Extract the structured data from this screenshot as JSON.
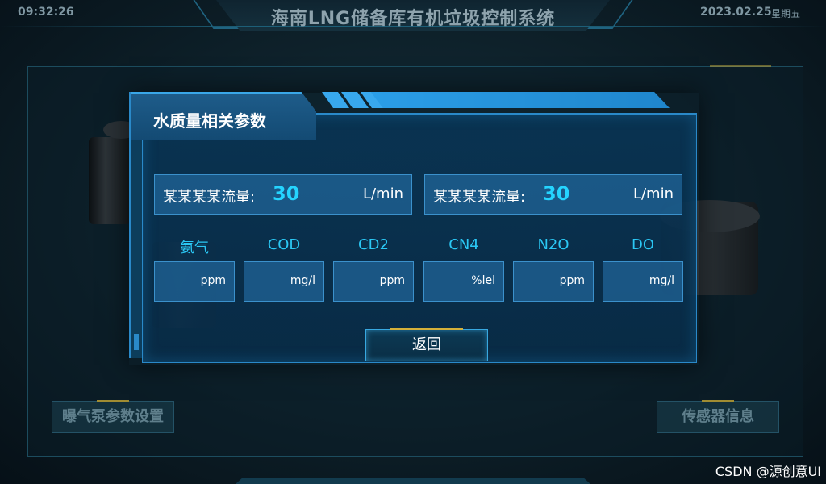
{
  "header": {
    "time": "09:32:26",
    "title": "海南LNG储备库有机垃圾控制系统",
    "date": "2023.02.25",
    "weekday": "星期五"
  },
  "background": {
    "left_button": "曝气泵参数设置",
    "right_button": "传感器信息"
  },
  "dialog": {
    "title": "水质量相关参数",
    "flows": [
      {
        "label": "某某某某流量:",
        "value": "30",
        "unit": "L/min"
      },
      {
        "label": "某某某某流量:",
        "value": "30",
        "unit": "L/min"
      }
    ],
    "params": [
      {
        "label": "氨气",
        "unit": "ppm"
      },
      {
        "label": "COD",
        "unit": "mg/l"
      },
      {
        "label": "CD2",
        "unit": "ppm"
      },
      {
        "label": "CN4",
        "unit": "%lel"
      },
      {
        "label": "N2O",
        "unit": "ppm"
      },
      {
        "label": "DO",
        "unit": "mg/l"
      }
    ],
    "back_label": "返回"
  },
  "watermark": "CSDN @源创意UI",
  "colors": {
    "accent": "#25d4ff",
    "panel_border": "#2a89c9",
    "highlight": "#d4b03a"
  }
}
